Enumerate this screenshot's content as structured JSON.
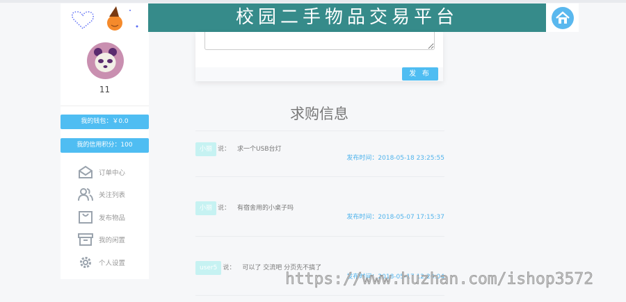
{
  "header": {
    "title": "校园二手物品交易平台",
    "home_icon": "home-icon",
    "accent": "#368b8a"
  },
  "sidebar": {
    "username": "11",
    "wallet": "我的钱包：￥0.0",
    "credit": "我的信用积分：100",
    "menu": [
      {
        "label": "订单中心",
        "icon": "mail-icon"
      },
      {
        "label": "关注列表",
        "icon": "users-icon"
      },
      {
        "label": "发布物品",
        "icon": "bag-icon"
      },
      {
        "label": "我的闲置",
        "icon": "archive-icon"
      },
      {
        "label": "个人设置",
        "icon": "gear-icon"
      }
    ]
  },
  "post": {
    "textarea_value": "",
    "publish_label": "发 布"
  },
  "section_title": "求购信息",
  "posts": [
    {
      "user": "小丽",
      "said": "说：",
      "message": "求一个USB台灯",
      "time": "发布时间：2018-05-18 23:25:55"
    },
    {
      "user": "小丽",
      "said": "说：",
      "message": "有宿舍用的小桌子吗",
      "time": "发布时间：2018-05-07 17:15:37"
    },
    {
      "user": "user5",
      "said": "说：",
      "message": "可以了 交流吧 分页先不搞了",
      "time": "发布时间：2018-05-17 12:20:04"
    }
  ],
  "watermark": "https://www.huzhan.com/ishop3572"
}
